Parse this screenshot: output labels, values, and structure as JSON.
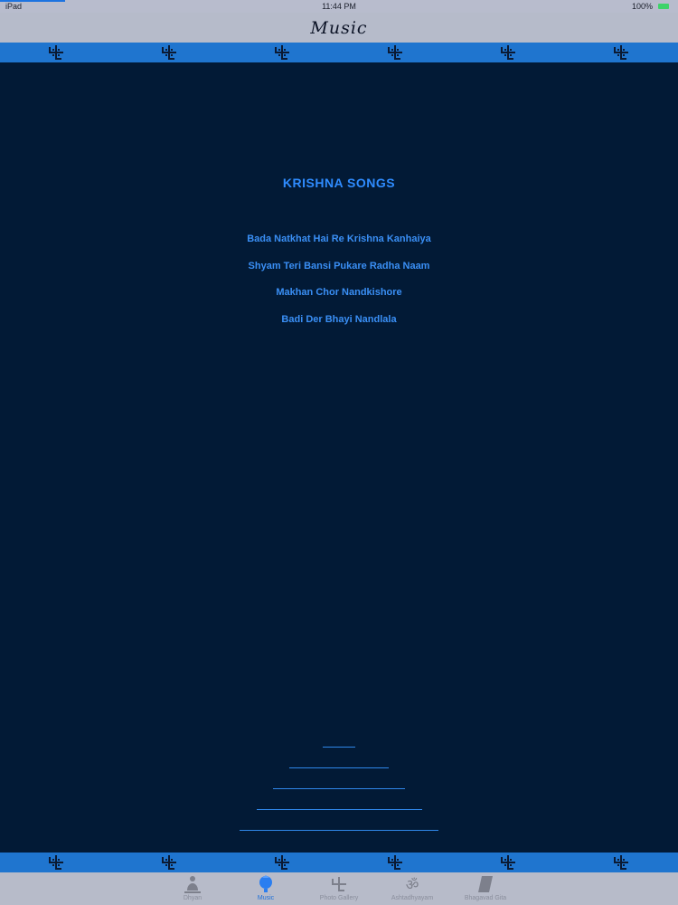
{
  "status_bar": {
    "carrier": "iPad",
    "time": "11:44 PM",
    "battery_pct": "100%"
  },
  "nav": {
    "title": "Music"
  },
  "pattern": {
    "icon": "swastika-icon",
    "color": "#0b1a33",
    "band_color": "#1f75cf"
  },
  "content": {
    "section_title": "KRISHNA SONGS",
    "songs": [
      "Bada Natkhat Hai Re Krishna Kanhaiya",
      "Shyam Teri Bansi Pukare Radha Naam",
      "Makhan Chor Nandkishore",
      "Badi Der Bhayi Nandlala"
    ]
  },
  "tabs": [
    {
      "label": "Dhyan",
      "icon": "meditation-icon",
      "active": false
    },
    {
      "label": "Music",
      "icon": "krishna-icon",
      "active": true
    },
    {
      "label": "Photo Gallery",
      "icon": "swastika-icon",
      "active": false
    },
    {
      "label": "Ashtadhyayam",
      "icon": "om-icon",
      "active": false
    },
    {
      "label": "Bhagavad Gita",
      "icon": "book-icon",
      "active": false
    }
  ],
  "colors": {
    "background": "#021a36",
    "accent": "#2f8cff",
    "tab_active": "#1d6fd8"
  }
}
